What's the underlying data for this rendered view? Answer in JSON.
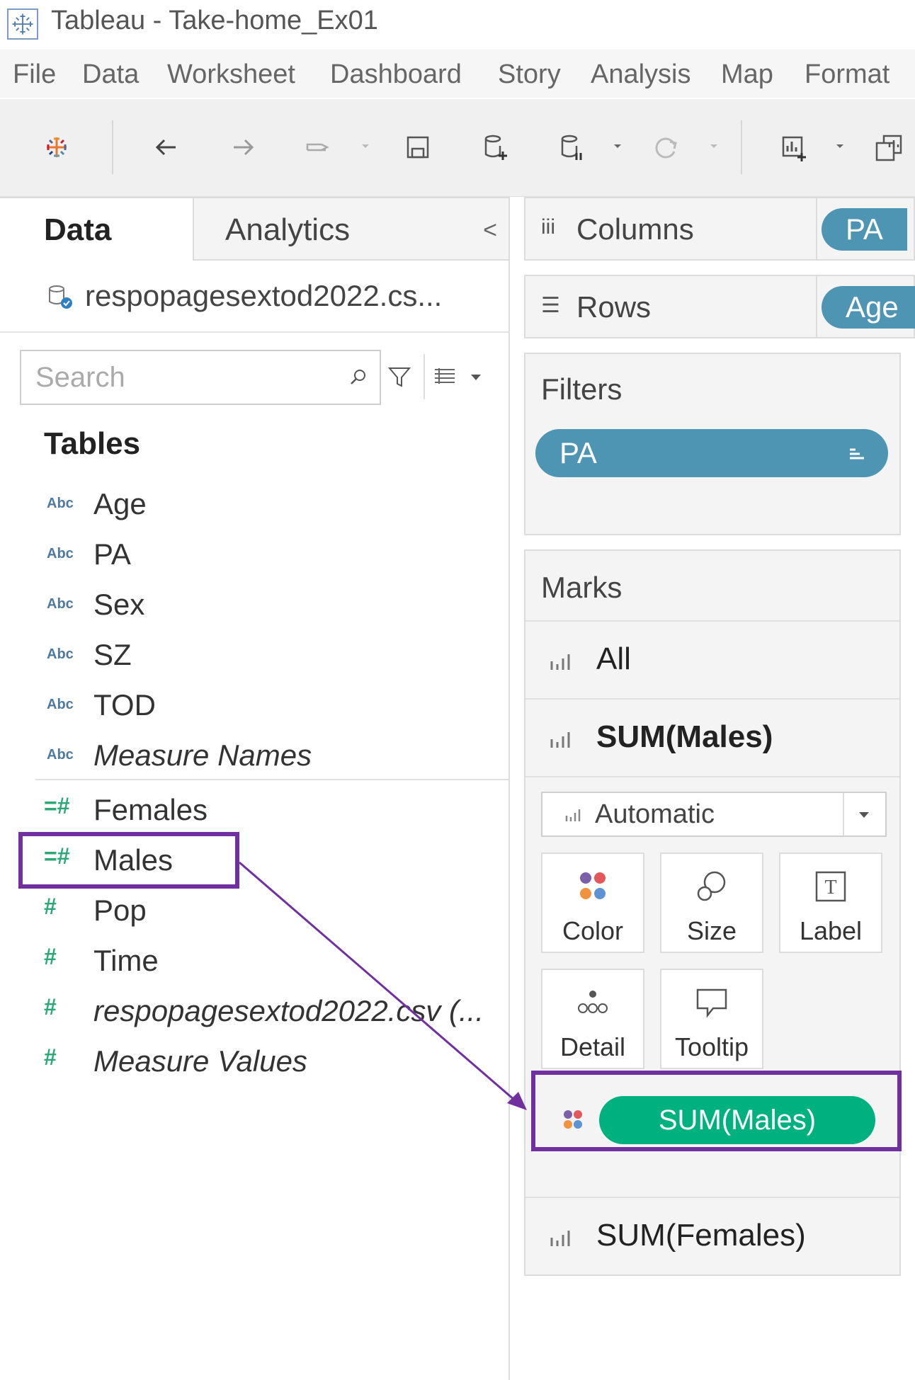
{
  "window": {
    "title": "Tableau - Take-home_Ex01"
  },
  "menu": [
    "File",
    "Data",
    "Worksheet",
    "Dashboard",
    "Story",
    "Analysis",
    "Map",
    "Format"
  ],
  "toolbar": {
    "icons": [
      "tableau-logo-icon",
      "undo-icon",
      "redo-icon",
      "replay-icon",
      "save-icon",
      "new-datasource-icon",
      "pause-updates-icon",
      "refresh-icon",
      "new-worksheet-icon",
      "duplicate-icon"
    ]
  },
  "left_pane": {
    "tabs": [
      {
        "label": "Data",
        "active": true
      },
      {
        "label": "Analytics",
        "active": false
      }
    ],
    "collapse_glyph": "<",
    "datasource": "respopagesextod2022.cs...",
    "search": {
      "placeholder": "Search",
      "value": ""
    },
    "tables_heading": "Tables",
    "dimensions": [
      {
        "type": "Abc",
        "name": "Age",
        "italic": false
      },
      {
        "type": "Abc",
        "name": "PA",
        "italic": false
      },
      {
        "type": "Abc",
        "name": "Sex",
        "italic": false
      },
      {
        "type": "Abc",
        "name": "SZ",
        "italic": false
      },
      {
        "type": "Abc",
        "name": "TOD",
        "italic": false
      },
      {
        "type": "Abc",
        "name": "Measure Names",
        "italic": true
      }
    ],
    "measures": [
      {
        "type": "=#",
        "name": "Females",
        "italic": false
      },
      {
        "type": "=#",
        "name": "Males",
        "italic": false
      },
      {
        "type": "#",
        "name": "Pop",
        "italic": false
      },
      {
        "type": "#",
        "name": "Time",
        "italic": false
      },
      {
        "type": "#",
        "name": "respopagesextod2022.csv (...",
        "italic": true
      },
      {
        "type": "#",
        "name": "Measure Values",
        "italic": true
      }
    ]
  },
  "shelves": {
    "columns": {
      "label": "Columns",
      "pill": "PA"
    },
    "rows": {
      "label": "Rows",
      "pill": "Age"
    }
  },
  "filters": {
    "title": "Filters",
    "pill": "PA"
  },
  "marks": {
    "title": "Marks",
    "all_label": "All",
    "sum_males_label": "SUM(Males)",
    "mark_type": "Automatic",
    "buttons": {
      "color": "Color",
      "size": "Size",
      "label": "Label",
      "detail": "Detail",
      "tooltip": "Tooltip"
    },
    "color_pill": "SUM(Males)",
    "sum_females_label": "SUM(Females)"
  },
  "colors": {
    "accent_pill": "#4e94b3",
    "measure_pill": "#00b180",
    "annotation": "#7030a0",
    "measure_icon": "#2aa876",
    "dimension_icon": "#4e7aa0"
  }
}
